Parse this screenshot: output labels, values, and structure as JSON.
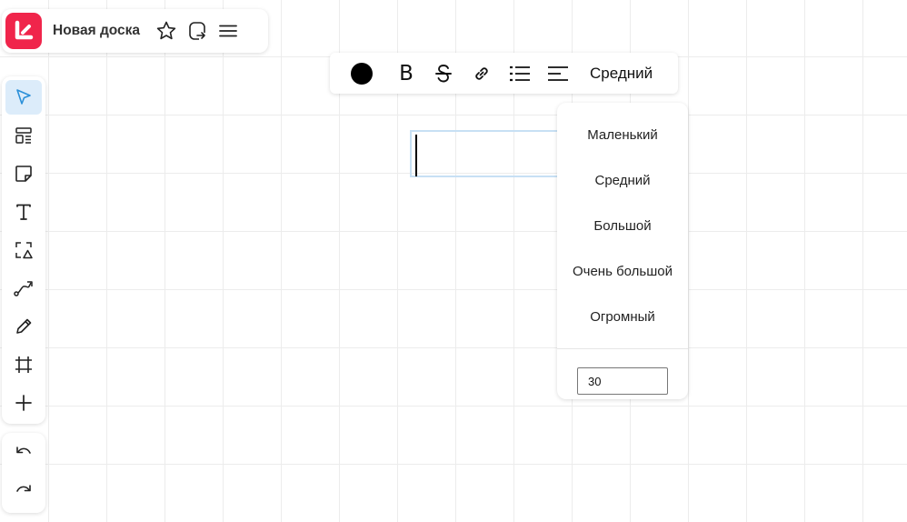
{
  "board": {
    "title": "Новая доска",
    "accent_color": "#f0254b",
    "icons": [
      "app-logo-icon",
      "star-icon",
      "share-icon",
      "menu-icon"
    ]
  },
  "left_toolbar": {
    "tools": [
      "select",
      "templates",
      "sticky-note",
      "text",
      "shapes",
      "connector",
      "pen",
      "frame",
      "more"
    ],
    "active_tool": "select",
    "history": [
      "undo",
      "redo"
    ]
  },
  "format_toolbar": {
    "text_color": "#000000",
    "bold_label": "B",
    "size_label": "Средний"
  },
  "size_menu": {
    "options": [
      "Маленький",
      "Средний",
      "Большой",
      "Очень большой",
      "Огромный"
    ],
    "custom_value": "30"
  }
}
